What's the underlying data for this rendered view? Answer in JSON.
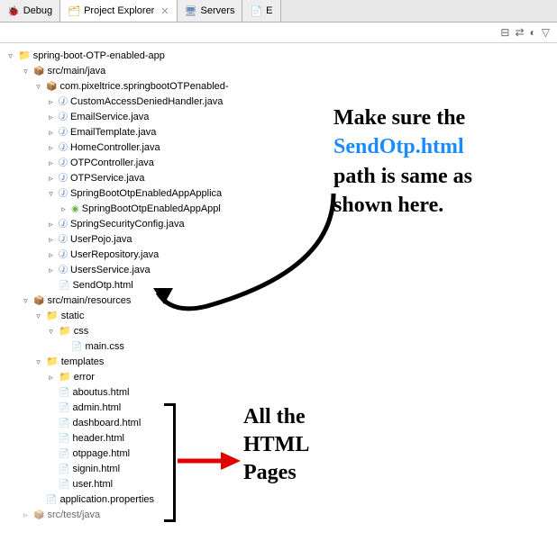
{
  "tabs": {
    "debug": "Debug",
    "explorer": "Project Explorer",
    "servers": "Servers",
    "partial": "E"
  },
  "tree": {
    "project": "spring-boot-OTP-enabled-app",
    "srcJava": "src/main/java",
    "pkg": "com.pixeltrice.springbootOTPenabled-",
    "j0": "CustomAccessDeniedHandler.java",
    "j1": "EmailService.java",
    "j2": "EmailTemplate.java",
    "j3": "HomeController.java",
    "j4": "OTPController.java",
    "j5": "OTPService.java",
    "j6": "SpringBootOtpEnabledAppApplica",
    "j6a": "SpringBootOtpEnabledAppAppl",
    "j7": "SpringSecurityConfig.java",
    "j8": "UserPojo.java",
    "j9": "UserRepository.java",
    "j10": "UsersService.java",
    "sendOtp": "SendOtp.html",
    "srcRes": "src/main/resources",
    "static": "static",
    "css": "css",
    "mainCss": "main.css",
    "templates": "templates",
    "error": "error",
    "h0": "aboutus.html",
    "h1": "admin.html",
    "h2": "dashboard.html",
    "h3": "header.html",
    "h4": "otppage.html",
    "h5": "signin.html",
    "h6": "user.html",
    "appProps": "application.properties",
    "srcTest": "src/test/java"
  },
  "annot1": {
    "l1": "Make sure the",
    "l2": "SendOtp.html",
    "l3": "path is same as",
    "l4": "shown here."
  },
  "annot2": {
    "l1": "All the",
    "l2": "HTML",
    "l3": "Pages"
  }
}
